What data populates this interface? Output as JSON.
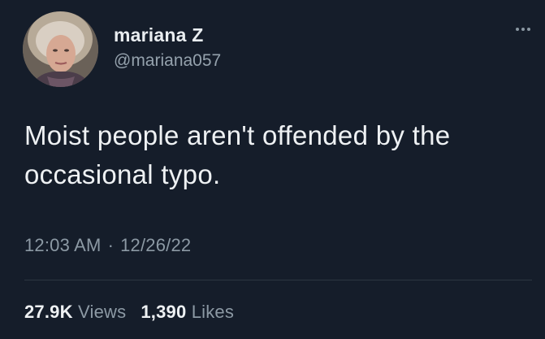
{
  "user": {
    "display_name": "mariana Z",
    "handle": "@mariana057",
    "avatar_icon": "profile-photo"
  },
  "menu": {
    "icon": "more-options-icon"
  },
  "tweet": {
    "text": "Moist people aren't offended by the occasional typo.",
    "time": "12:03 AM",
    "separator": "·",
    "date": "12/26/22"
  },
  "stats": {
    "views_count": "27.9K",
    "views_label": "Views",
    "likes_count": "1,390",
    "likes_label": "Likes"
  },
  "colors": {
    "background": "#151d2a",
    "primary_text": "#eef1f3",
    "secondary_text": "#8c99a4"
  }
}
